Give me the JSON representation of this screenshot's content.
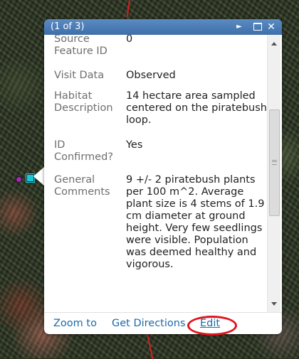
{
  "popup": {
    "title": "(1 of 3)",
    "fields": [
      {
        "label": "Source Feature ID",
        "value": "0"
      },
      {
        "label": "Visit Data",
        "value": "Observed"
      },
      {
        "label": "Habitat Description",
        "value": "14 hectare area sampled centered on the piratebush loop."
      },
      {
        "label": "ID Confirmed?",
        "value": "Yes"
      },
      {
        "label": "General Comments",
        "value": "9 +/- 2 piratebush plants per 100 m^2. Average plant size is 4 stems of 1.9 cm diameter at ground height. Very few seedlings were visible. Population was deemed healthy and vigorous."
      }
    ],
    "footer": {
      "zoom_label": "Zoom to",
      "directions_label": "Get Directions",
      "edit_label": "Edit"
    },
    "controls": {
      "next_icon": "►",
      "close_icon": "✕"
    }
  },
  "colors": {
    "titlebar": "#4a7cb7",
    "link": "#1c6aa8",
    "highlight_circle": "#e2141c",
    "selected_marker": "#19c7d6"
  }
}
